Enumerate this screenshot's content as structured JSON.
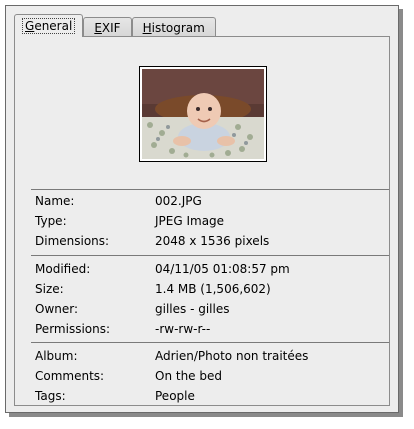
{
  "tabs": [
    {
      "label_pre": "",
      "label_u": "G",
      "label_post": "eneral"
    },
    {
      "label_pre": "",
      "label_u": "E",
      "label_post": "XIF"
    },
    {
      "label_pre": "",
      "label_u": "H",
      "label_post": "istogram"
    }
  ],
  "thumbnail": {
    "icon": "photo-thumbnail"
  },
  "general": {
    "name_label": "Name:",
    "name_value": "002.JPG",
    "type_label": "Type:",
    "type_value": "JPEG Image",
    "dimensions_label": "Dimensions:",
    "dimensions_value": "2048 x 1536 pixels"
  },
  "file": {
    "modified_label": "Modified:",
    "modified_value": "04/11/05 01:08:57 pm",
    "size_label": "Size:",
    "size_value": "1.4 MB (1,506,602)",
    "owner_label": "Owner:",
    "owner_value": "gilles - gilles",
    "permissions_label": "Permissions:",
    "permissions_value": "-rw-rw-r--"
  },
  "meta": {
    "album_label": "Album:",
    "album_value": "Adrien/Photo non traitées",
    "comments_label": "Comments:",
    "comments_value": "On the bed",
    "tags_label": "Tags:",
    "tags_value": "People"
  }
}
